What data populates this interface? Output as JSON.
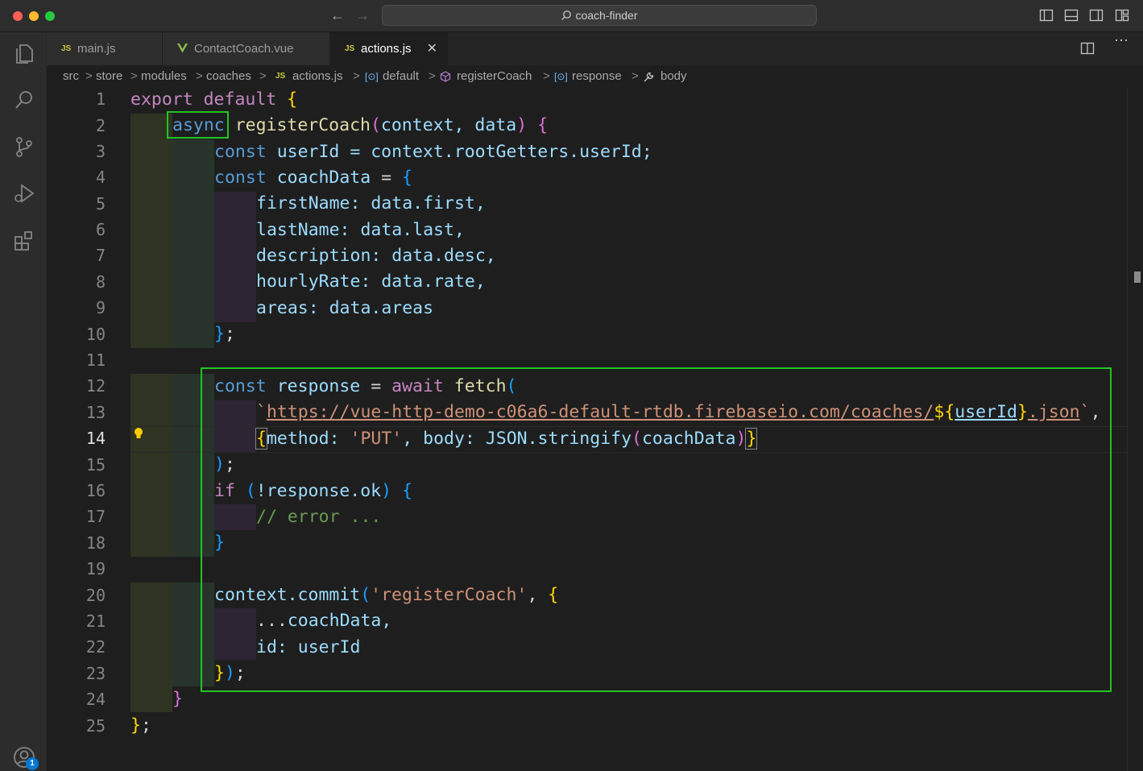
{
  "window": {
    "title": "coach-finder"
  },
  "tabs": [
    {
      "label": "main.js",
      "icon": "js-icon",
      "active": false
    },
    {
      "label": "ContactCoach.vue",
      "icon": "vue-icon",
      "active": false
    },
    {
      "label": "actions.js",
      "icon": "js-icon",
      "active": true,
      "close": "✕"
    }
  ],
  "breadcrumbs": {
    "items": [
      "src",
      "store",
      "modules",
      "coaches",
      "actions.js",
      "default",
      "registerCoach",
      "response",
      "body"
    ],
    "separator": ">"
  },
  "editor": {
    "current_line": 14,
    "line_numbers": [
      "1",
      "2",
      "3",
      "4",
      "5",
      "6",
      "7",
      "8",
      "9",
      "10",
      "11",
      "12",
      "13",
      "14",
      "15",
      "16",
      "17",
      "18",
      "19",
      "20",
      "21",
      "22",
      "23",
      "24",
      "25"
    ]
  },
  "code": {
    "l1_export": "export default",
    "l1_brace": "{",
    "l2_async": "async",
    "l2_fn": "registerCoach",
    "l2_po": "(",
    "l2_params": "context, data",
    "l2_pc": ")",
    "l2_brace": "{",
    "l3_const": "const",
    "l3_var": "userId",
    "l3_rest": "= context.rootGetters.userId;",
    "l4_const": "const",
    "l4_var": "coachData",
    "l4_eq": "=",
    "l4_brace": "{",
    "l5": "firstName: data.first,",
    "l6": "lastName: data.last,",
    "l7": "description: data.desc,",
    "l8": "hourlyRate: data.rate,",
    "l9": "areas: data.areas",
    "l10_brace": "}",
    "l10_semi": ";",
    "l12_const": "const",
    "l12_var": "response",
    "l12_eq": "=",
    "l12_await": "await",
    "l12_fetch": "fetch",
    "l12_po": "(",
    "l13_tick": "`",
    "l13_url": "https://vue-http-demo-c06a6-default-rtdb.firebaseio.com/coaches/",
    "l13_dollar": "$",
    "l13_ob": "{",
    "l13_var": "userId",
    "l13_cb": "}",
    "l13_json": ".json",
    "l13_tick2": "`",
    "l13_comma": ",",
    "l14_ob": "{",
    "l14_method": "method: ",
    "l14_put": "'PUT'",
    "l14_body": ", body: JSON.stringify",
    "l14_po": "(",
    "l14_var": "coachData",
    "l14_pc": ")",
    "l14_cb": "}",
    "l15_pc": ")",
    "l15_semi": ";",
    "l16_if": "if",
    "l16_po": "(",
    "l16_rest": "!response.ok",
    "l16_pc": ")",
    "l16_brace": "{",
    "l17_comment": "// error ...",
    "l18_brace": "}",
    "l20_ctx": "context.commit",
    "l20_po": "(",
    "l20_str": "'registerCoach'",
    "l20_comma": ",",
    "l20_brace": "{",
    "l21_spread": "...",
    "l21_var": "coachData,",
    "l22_key": "id: ",
    "l22_var": "userId",
    "l23_cb": "}",
    "l23_pc": ")",
    "l23_semi": ";",
    "l24_brace": "}",
    "l25_brace": "}",
    "l25_semi": ";"
  },
  "accounts_badge": "1",
  "colors": {
    "keyword": "#c586c0",
    "storage": "#569cd6",
    "variable": "#9cdcfe",
    "function": "#dcdcaa",
    "string": "#ce9178",
    "comment": "#6a9955",
    "highlight_box": "#22c422"
  }
}
